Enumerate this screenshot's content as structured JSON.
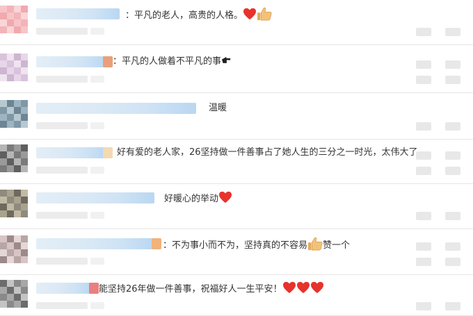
{
  "colors": {
    "heart": "#e8322c",
    "thumb": "#f2c27a",
    "divider": "#e6e6e6"
  },
  "comments": [
    {
      "name_blur_width": 120,
      "accent": "",
      "text": "：平凡的老人，高贵的人格。",
      "icons": [
        "heart-icon",
        "thumbs-up-icon"
      ],
      "after_text": ""
    },
    {
      "name_blur_width": 100,
      "accent": "#e9a07a",
      "text": "：平凡的人做着不平凡的事",
      "icons": [
        "pointing-hand-icon"
      ],
      "after_text": ""
    },
    {
      "name_blur_width": 230,
      "accent": "",
      "text": "温暖",
      "icons": [],
      "after_text": ""
    },
    {
      "name_blur_width": 100,
      "accent": "#f4d9b2",
      "text": "好有爱的老人家，26坚持做一件善事占了她人生的三分之一时光，太伟大了",
      "icons": [],
      "after_text": ""
    },
    {
      "name_blur_width": 170,
      "accent": "",
      "text": "好暖心的举动",
      "icons": [
        "heart-icon"
      ],
      "after_text": ""
    },
    {
      "name_blur_width": 170,
      "accent": "#f2b27a",
      "text": "：不为事小而不为，坚持真的不容易",
      "icons": [
        "thumbs-up-icon"
      ],
      "after_text": "赞一个"
    },
    {
      "name_blur_width": 80,
      "accent": "#e98080",
      "text": "能坚持26年做一件善事，祝福好人一生平安！",
      "icons": [
        "heart-icon",
        "heart-icon",
        "heart-icon"
      ],
      "after_text": ""
    }
  ]
}
